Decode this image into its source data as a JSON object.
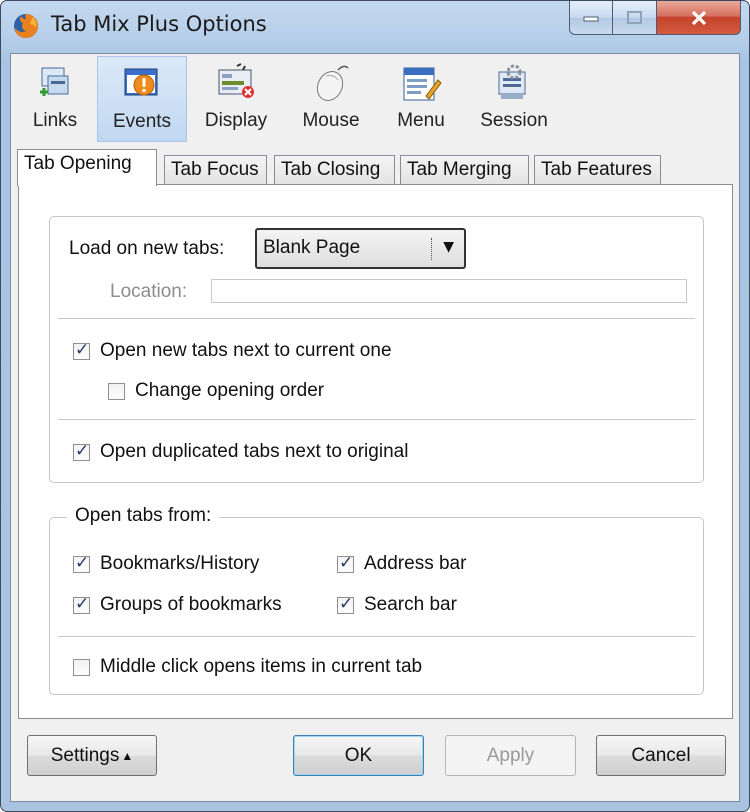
{
  "window": {
    "title": "Tab Mix Plus Options"
  },
  "toolbar": {
    "items": [
      {
        "label": "Links"
      },
      {
        "label": "Events"
      },
      {
        "label": "Display"
      },
      {
        "label": "Mouse"
      },
      {
        "label": "Menu"
      },
      {
        "label": "Session"
      }
    ],
    "selected": "Events"
  },
  "tabs": [
    "Tab Opening",
    "Tab Focus",
    "Tab Closing",
    "Tab Merging",
    "Tab Features"
  ],
  "active_tab": "Tab Opening",
  "new_tabs": {
    "load_label": "Load on new tabs:",
    "load_value": "Blank Page",
    "location_label": "Location:",
    "location_value": "",
    "open_next_label": "Open new tabs next to current one",
    "open_next_checked": true,
    "change_order_label": "Change opening order",
    "change_order_checked": false,
    "duplicated_label": "Open duplicated tabs next to original",
    "duplicated_checked": true
  },
  "open_from": {
    "legend": "Open tabs from:",
    "bookmarks_history": "Bookmarks/History",
    "address_bar": "Address bar",
    "groups_bookmarks": "Groups of bookmarks",
    "search_bar": "Search bar",
    "middle_click": "Middle click opens items in current tab",
    "bookmarks_history_checked": true,
    "address_bar_checked": true,
    "groups_bookmarks_checked": true,
    "search_bar_checked": true,
    "middle_click_checked": false
  },
  "buttons": {
    "settings": "Settings",
    "ok": "OK",
    "apply": "Apply",
    "cancel": "Cancel"
  },
  "icons": {
    "dropdown_arrow": "▼",
    "settings_arrow": "▲",
    "check": "✓"
  },
  "colors": {
    "title_bar": "#b5cde8",
    "selected_toolbar": "#c1d8f2",
    "close_button": "#c4432c",
    "check_mark": "#253a64"
  }
}
